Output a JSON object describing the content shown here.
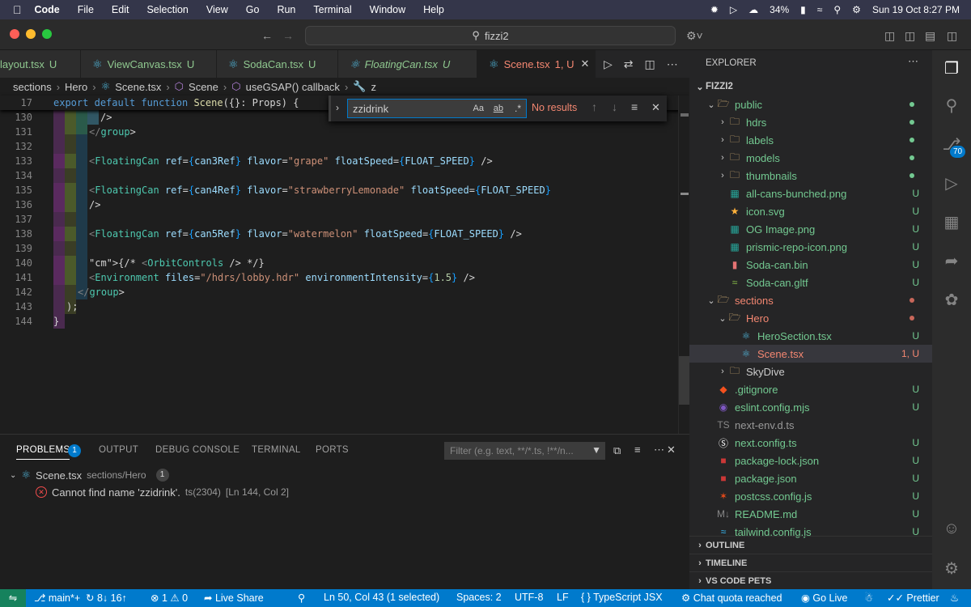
{
  "menubar": {
    "app": "Code",
    "items": [
      "File",
      "Edit",
      "Selection",
      "View",
      "Go",
      "Run",
      "Terminal",
      "Window",
      "Help"
    ],
    "battery": "34%",
    "datetime": "Sun 19 Oct  8:27 PM"
  },
  "titlebar": {
    "search": "fizzi2"
  },
  "tabs": [
    {
      "label": "layout.tsx",
      "status": "U",
      "italic": false
    },
    {
      "label": "ViewCanvas.tsx",
      "status": "U",
      "italic": false
    },
    {
      "label": "SodaCan.tsx",
      "status": "U",
      "italic": false
    },
    {
      "label": "FloatingCan.tsx",
      "status": "U",
      "italic": true
    },
    {
      "label": "Scene.tsx",
      "status": "1, U",
      "italic": false
    }
  ],
  "breadcrumb": [
    "sections",
    "Hero",
    "Scene.tsx",
    "Scene",
    "useGSAP() callback",
    "z"
  ],
  "find": {
    "query": "zzidrink",
    "result": "No results",
    "opt_case": "Aa",
    "opt_word": "ab",
    "opt_regex": ".*"
  },
  "editor": {
    "sticky": {
      "ln": "17",
      "kw1": "export",
      "kw2": "default",
      "kw3": "function",
      "fn": "Scene",
      "rest": "({}: Props) {"
    },
    "lines": [
      {
        "ln": "130",
        "text": "/>"
      },
      {
        "ln": "131",
        "text": "</group>"
      },
      {
        "ln": "132",
        "text": ""
      },
      {
        "ln": "133",
        "text": "<FloatingCan ref={can3Ref} flavor=\"grape\" floatSpeed={FLOAT_SPEED} />"
      },
      {
        "ln": "134",
        "text": ""
      },
      {
        "ln": "135",
        "text": "<FloatingCan ref={can4Ref} flavor=\"strawberryLemonade\" floatSpeed={FLOAT_SPEED}"
      },
      {
        "ln": "136",
        "text": "/>"
      },
      {
        "ln": "137",
        "text": ""
      },
      {
        "ln": "138",
        "text": "<FloatingCan ref={can5Ref} flavor=\"watermelon\" floatSpeed={FLOAT_SPEED} />"
      },
      {
        "ln": "139",
        "text": ""
      },
      {
        "ln": "140",
        "text": "{/* <OrbitControls /> */}"
      },
      {
        "ln": "141",
        "text": "<Environment files=\"/hdrs/lobby.hdr\" environmentIntensity={1.5} />"
      },
      {
        "ln": "142",
        "text": "</group>"
      },
      {
        "ln": "143",
        "text": ");"
      },
      {
        "ln": "144",
        "text": "}"
      }
    ]
  },
  "panel": {
    "tabs": [
      "PROBLEMS",
      "OUTPUT",
      "DEBUG CONSOLE",
      "TERMINAL",
      "PORTS"
    ],
    "problems_count": "1",
    "filter_placeholder": "Filter (e.g. text, **/*.ts, !**/n...",
    "file": "Scene.tsx",
    "path": "sections/Hero",
    "file_count": "1",
    "error": "Cannot find name 'zzidrink'.",
    "code": "ts(2304)",
    "loc": "[Ln 144, Col 2]"
  },
  "explorer": {
    "title": "EXPLORER",
    "project": "FIZZI2",
    "items": [
      {
        "label": "public",
        "indent": 1,
        "kind": "folder-open",
        "status": "",
        "dot": "#73c991"
      },
      {
        "label": "hdrs",
        "indent": 2,
        "kind": "folder",
        "status": "",
        "dot": "#73c991"
      },
      {
        "label": "labels",
        "indent": 2,
        "kind": "folder",
        "status": "",
        "dot": "#73c991"
      },
      {
        "label": "models",
        "indent": 2,
        "kind": "folder",
        "status": "",
        "dot": "#73c991"
      },
      {
        "label": "thumbnails",
        "indent": 2,
        "kind": "folder",
        "status": "",
        "dot": "#73c991"
      },
      {
        "label": "all-cans-bunched.png",
        "indent": 2,
        "kind": "image",
        "status": "U"
      },
      {
        "label": "icon.svg",
        "indent": 2,
        "kind": "svg",
        "status": "U"
      },
      {
        "label": "OG Image.png",
        "indent": 2,
        "kind": "image",
        "status": "U"
      },
      {
        "label": "prismic-repo-icon.png",
        "indent": 2,
        "kind": "image",
        "status": "U"
      },
      {
        "label": "Soda-can.bin",
        "indent": 2,
        "kind": "bin",
        "status": "U"
      },
      {
        "label": "Soda-can.gltf",
        "indent": 2,
        "kind": "gltf",
        "status": "U"
      },
      {
        "label": "sections",
        "indent": 1,
        "kind": "folder-open",
        "status": "",
        "dot": "#c8675a",
        "red": true
      },
      {
        "label": "Hero",
        "indent": 2,
        "kind": "folder-open",
        "status": "",
        "dot": "#c8675a",
        "red": true
      },
      {
        "label": "HeroSection.tsx",
        "indent": 3,
        "kind": "react",
        "status": "U"
      },
      {
        "label": "Scene.tsx",
        "indent": 3,
        "kind": "react",
        "status": "1, U",
        "red": true,
        "selected": true
      },
      {
        "label": "SkyDive",
        "indent": 2,
        "kind": "folder",
        "status": ""
      },
      {
        "label": ".gitignore",
        "indent": 1,
        "kind": "git",
        "status": "U"
      },
      {
        "label": "eslint.config.mjs",
        "indent": 1,
        "kind": "eslint",
        "status": "U"
      },
      {
        "label": "next-env.d.ts",
        "indent": 1,
        "kind": "ts",
        "status": "",
        "grey": true
      },
      {
        "label": "next.config.ts",
        "indent": 1,
        "kind": "next",
        "status": "U"
      },
      {
        "label": "package-lock.json",
        "indent": 1,
        "kind": "npm",
        "status": "U"
      },
      {
        "label": "package.json",
        "indent": 1,
        "kind": "npm",
        "status": "U"
      },
      {
        "label": "postcss.config.js",
        "indent": 1,
        "kind": "postcss",
        "status": "U"
      },
      {
        "label": "README.md",
        "indent": 1,
        "kind": "md",
        "status": "U"
      },
      {
        "label": "tailwind.config.js",
        "indent": 1,
        "kind": "tailwind",
        "status": "U"
      }
    ],
    "sections": [
      "OUTLINE",
      "TIMELINE",
      "VS CODE PETS"
    ]
  },
  "activity": {
    "scm_badge": "70"
  },
  "status": {
    "branch": "main*+",
    "sync": "8↓ 16↑",
    "errors": "1",
    "warnings": "0",
    "liveshare": "Live Share",
    "cursor": "Ln 50, Col 43 (1 selected)",
    "spaces": "Spaces: 2",
    "encoding": "UTF-8",
    "eol": "LF",
    "lang": "TypeScript JSX",
    "chat": "Chat quota reached",
    "golive": "Go Live",
    "prettier": "Prettier"
  }
}
